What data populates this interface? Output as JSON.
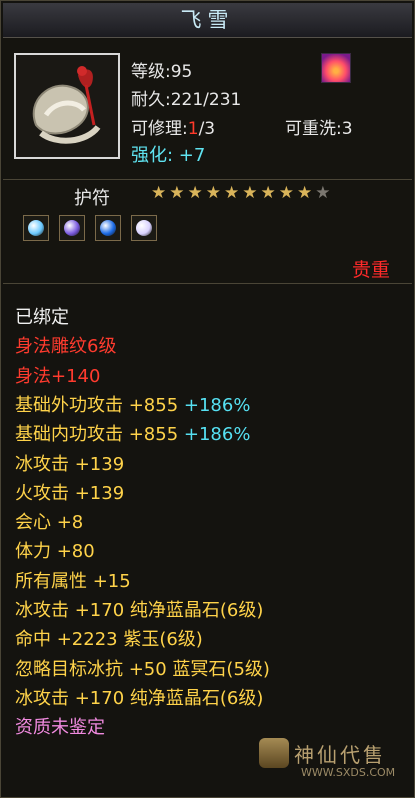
{
  "title": "飞雪",
  "header": {
    "level": "等级:95",
    "durability": "耐久:221/231",
    "repair_label": "可修理:",
    "repair_current": "1",
    "repair_max": "/3",
    "rewash": "可重洗:3",
    "enhance": "强化: +7"
  },
  "amulet_label": "护符",
  "stars": {
    "filled": 9,
    "total": 10
  },
  "gems": [
    {
      "icon": "gem-diamond-icon",
      "color": "#6ac9ff"
    },
    {
      "icon": "gem-purple-icon",
      "color": "#7b5be0"
    },
    {
      "icon": "gem-blue-icon",
      "color": "#1c6be6"
    },
    {
      "icon": "gem-pearl-icon",
      "color": "#d9d2ff"
    }
  ],
  "precious_label": "贵重",
  "stats": [
    {
      "text": "已绑定",
      "color": "white"
    },
    {
      "text": "身法雕纹6级",
      "color": "red"
    },
    {
      "text": "身法+140",
      "color": "red"
    },
    {
      "text": "基础外功攻击 +855",
      "extra": " +186%",
      "color": "yellow"
    },
    {
      "text": "基础内功攻击 +855",
      "extra": " +186%",
      "color": "yellow"
    },
    {
      "text": "冰攻击 +139",
      "color": "yellow"
    },
    {
      "text": "火攻击 +139",
      "color": "yellow"
    },
    {
      "text": "会心 +8",
      "color": "yellow"
    },
    {
      "text": "体力 +80",
      "color": "yellow"
    },
    {
      "text": "所有属性 +15",
      "color": "yellow"
    },
    {
      "text": "冰攻击 +170 纯净蓝晶石(6级)",
      "color": "yellow"
    },
    {
      "text": "命中 +2223 紫玉(6级)",
      "color": "yellow"
    },
    {
      "text": "忽略目标冰抗 +50 蓝冥石(5级)",
      "color": "yellow"
    },
    {
      "text": "冰攻击 +170 纯净蓝晶石(6级)",
      "color": "yellow"
    },
    {
      "text": "资质未鉴定",
      "color": "pink"
    }
  ],
  "watermark": {
    "name": "神仙代售",
    "url": "WWW.SXDS.COM"
  }
}
